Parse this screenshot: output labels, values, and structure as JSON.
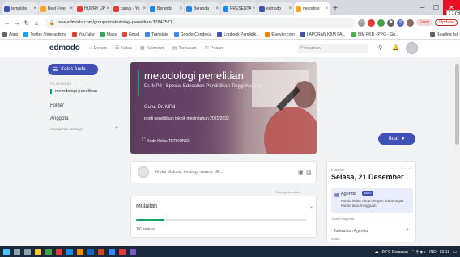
{
  "browser": {
    "tabs": [
      {
        "title": "template",
        "color": "#3f51b5",
        "active": false
      },
      {
        "title": "Best Free",
        "color": "#f5a623",
        "active": false
      },
      {
        "title": "HURRY UP",
        "color": "#e53935",
        "active": false
      },
      {
        "title": "canva - Yo",
        "color": "#e53935",
        "active": false
      },
      {
        "title": "Beranda",
        "color": "#1e88e5",
        "active": false
      },
      {
        "title": "Beranda",
        "color": "#1e88e5",
        "active": false
      },
      {
        "title": "PRESENTA",
        "color": "#1e88e5",
        "active": false
      },
      {
        "title": "edmodo",
        "color": "#3f51b5",
        "active": false
      },
      {
        "title": "metodolo",
        "color": "#f5a623",
        "active": true
      }
    ],
    "new_tab": "+",
    "close_tooltip": "Close",
    "url": "new.edmodo.com/groups/metodologi-penelitian-37842571",
    "error_label": "Error",
    "update_label": "Update",
    "bookmarks": [
      {
        "label": "Apps",
        "color": "#5f6368"
      },
      {
        "label": "Twitter / Interactions",
        "color": "#1da1f2"
      },
      {
        "label": "YouTube",
        "color": "#e53935"
      },
      {
        "label": "Maps",
        "color": "#34a853"
      },
      {
        "label": "Gmail",
        "color": "#ea4335"
      },
      {
        "label": "Translate",
        "color": "#4285f4"
      },
      {
        "label": "Google Cendekia",
        "color": "#4285f4"
      },
      {
        "label": "Logbook Pendidik...",
        "color": "#3f51b5"
      },
      {
        "label": "Elsevier.com",
        "color": "#f57c00"
      },
      {
        "label": "LAPORAN KBM PA...",
        "color": "#3f51b5"
      },
      {
        "label": "SIM PKB - PPG - Gu...",
        "color": "#4caf50"
      }
    ],
    "reading_list": "Reading list"
  },
  "edmodo": {
    "logo": "edmodo",
    "nav": [
      {
        "label": "Depan",
        "icon": "home-icon",
        "glyph": "⌂"
      },
      {
        "label": "Kelas",
        "icon": "classes-icon",
        "glyph": "☷"
      },
      {
        "label": "Kalender",
        "icon": "calendar-icon",
        "glyph": "▦"
      },
      {
        "label": "Tersusun",
        "icon": "library-icon",
        "glyph": "▤"
      },
      {
        "label": "Pesan",
        "icon": "message-icon",
        "glyph": "✉"
      }
    ],
    "search_placeholder": "Pencarian"
  },
  "sidebar": {
    "kelas_button": "Kelas Anda",
    "section_label": "PILIH KELAS",
    "class_name": "metodologi penelitian",
    "folder": "Folder",
    "anggota": "Anggota",
    "kelompok": "KELOMPOK KECIL (0)"
  },
  "banner": {
    "title": "metodologi penelitian",
    "subtitle": "Dr. MPd | Special Education   Pendidikan Tinggi Karang",
    "guru": "Guru: Dr. MPd",
    "prodi": "prodi pendidikan teknik mesin tahun 2021/2022",
    "kode": "Kode Kelas TERKUNCI",
    "buat": "Buat"
  },
  "post": {
    "placeholder": "Mulai diskusi, berbagi materi, dll...",
    "sort_label": "Saring post dari ▾"
  },
  "start": {
    "title": "Mulailah",
    "progress": 0.167,
    "count": "1/6 selesai"
  },
  "calendar": {
    "label": "Kalender",
    "date": "Selasa, 21 Desember",
    "agenda_title": "Agenda",
    "agenda_badge": "BARU",
    "agenda_desc": "Pandu kelas Anda dengan daftar tugas harian atau mingguan.",
    "today_label": "Today's Agenda",
    "jadwal": "Jadwalkan Agenda",
    "next_label": "Kuota"
  },
  "taskbar": {
    "weather": "26°C  Berawan",
    "lang": "IND",
    "time": "23:19"
  }
}
